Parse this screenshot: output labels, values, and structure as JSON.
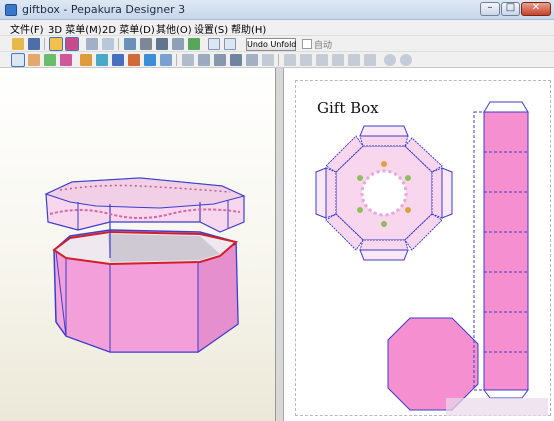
{
  "window": {
    "title": "giftbox - Pepakura Designer 3",
    "minimize_glyph": "–",
    "maximize_glyph": "□",
    "close_glyph": "✕"
  },
  "menu": {
    "items": [
      {
        "label": "文件(F)"
      },
      {
        "label": "3D 菜单(M)"
      },
      {
        "label": "2D 菜单(D)"
      },
      {
        "label": "其他(O)"
      },
      {
        "label": "设置(S)"
      },
      {
        "label": "帮助(H)"
      }
    ]
  },
  "toolbar": {
    "undo_unfold_label": "Undo Unfold",
    "auto_label": "自动",
    "auto_checked": false
  },
  "canvas2d": {
    "page_title": "Gift Box"
  },
  "colors": {
    "box_pink": "#f4a6dd",
    "box_pink_dark": "#d87cc2",
    "box_lid": "#f7d6ee",
    "cut_outline": "#d21f2a",
    "edge_blue": "#3d3dcc",
    "strip_pink": "#f58fcf"
  }
}
